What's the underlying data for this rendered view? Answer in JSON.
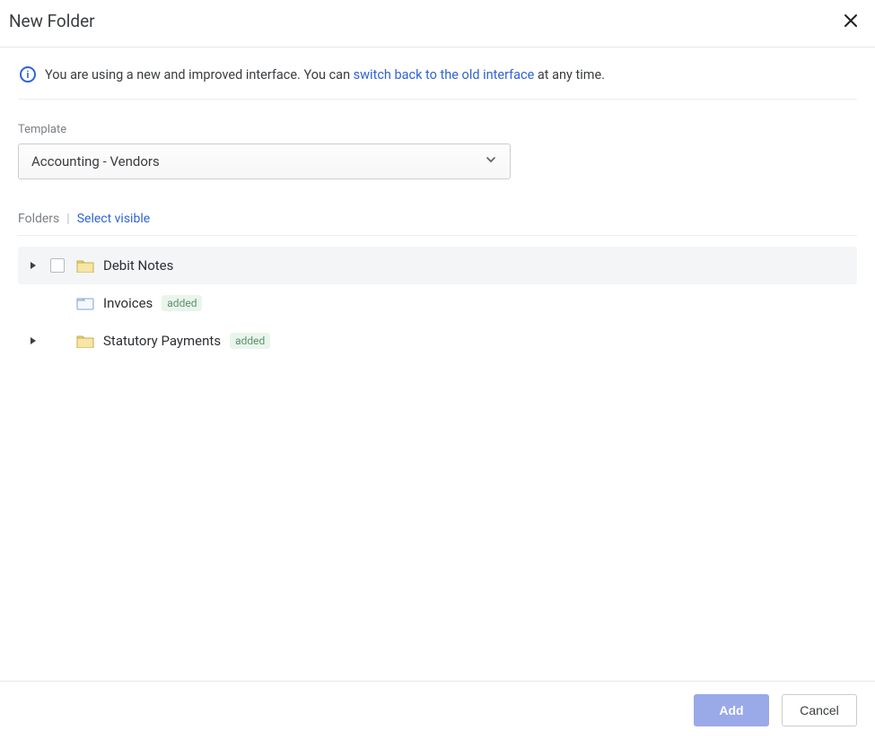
{
  "header": {
    "title": "New Folder"
  },
  "banner": {
    "prefix": "You are using a new and improved interface. You can ",
    "link_text": "switch back to the old interface",
    "suffix": " at any time."
  },
  "template": {
    "label": "Template",
    "selected": "Accounting - Vendors"
  },
  "folders_bar": {
    "label": "Folders",
    "action": "Select visible"
  },
  "badge_text": "added",
  "items": [
    {
      "name": "Debit Notes",
      "expandable": true,
      "checkbox": true,
      "added": false,
      "highlight": true,
      "open_folder": false
    },
    {
      "name": "Invoices",
      "expandable": false,
      "checkbox": false,
      "added": true,
      "highlight": false,
      "open_folder": true
    },
    {
      "name": "Statutory Payments",
      "expandable": true,
      "checkbox": false,
      "added": true,
      "highlight": false,
      "open_folder": false
    }
  ],
  "footer": {
    "primary": "Add",
    "secondary": "Cancel"
  }
}
